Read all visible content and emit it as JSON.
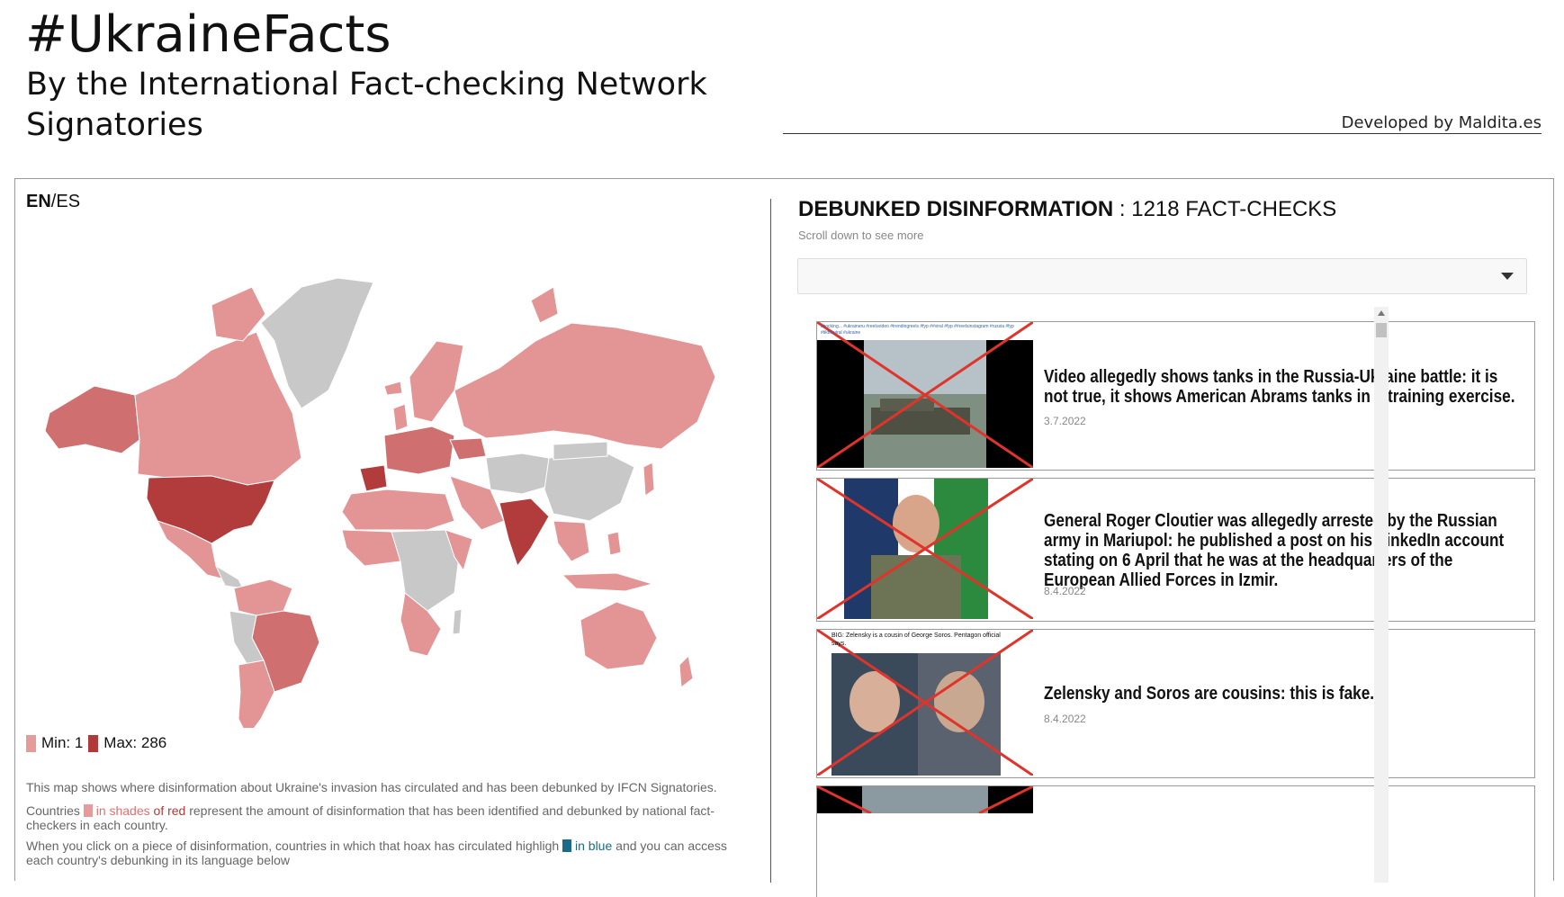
{
  "header": {
    "title": "#UkraineFacts",
    "subtitle": "By the International Fact-checking Network Signatories",
    "credit": "Developed by Maldita.es"
  },
  "lang": {
    "active": "EN",
    "sep": "/",
    "other": "ES"
  },
  "legend": {
    "min_label": "Min: 1",
    "max_label": "Max: 286",
    "min_color": "#e69a9a",
    "max_color": "#b03a3a"
  },
  "description": {
    "p1": "This map shows where disinformation about Ukraine's invasion has circulated and has been debunked by IFCN Signatories.",
    "p2_a": "Countries",
    "p2_b": "in shades",
    "p2_c": "of red",
    "p2_d": "represent the amount of disinformation that has been identified and debunked by national fact-checkers in each country.",
    "p3_a": "When you click on a piece of disinformation, countries in which that hoax has circulated highligh",
    "p3_b": "in blue",
    "p3_c": "and you can access each country's debunking in its language below"
  },
  "feed_header": {
    "label": "DEBUNKED DISINFORMATION",
    "count": ": 1218 FACT-CHECKS",
    "hint": "Scroll down to see more"
  },
  "dropdown": {
    "value": ""
  },
  "cards": [
    {
      "title": "Video allegedly shows tanks in the Russia-Ukraine battle: it is not true, it shows American Abrams tanks in a training exercise.",
      "date": "3.7.2022",
      "thumb_caption": "shocking... #ukraineru #reelsvideo #trendingreels #fyp ##viral #fyp ##reelsinstagram #russia #fyp #tiktokviral #ukraine"
    },
    {
      "title": "General Roger Cloutier was allegedly arrested by the Russian army in Mariupol: he published a post on his LinkedIn account stating on 6 April that he was at the headquarters of the European Allied Forces in Izmir.",
      "date": "8.4.2022",
      "thumb_caption": ""
    },
    {
      "title": "Zelensky and Soros are cousins: this is fake.",
      "date": "8.4.2022",
      "thumb_caption": "BIG: Zelensky is a cousin of George Soros. Pentagon official says."
    }
  ],
  "colors": {
    "red_max": "#b23b3b",
    "red_mid": "#cf6f6f",
    "red_light": "#e39494",
    "gray": "#c8c8c8",
    "blue": "#1a6b8a",
    "cross": "#e0342b"
  }
}
